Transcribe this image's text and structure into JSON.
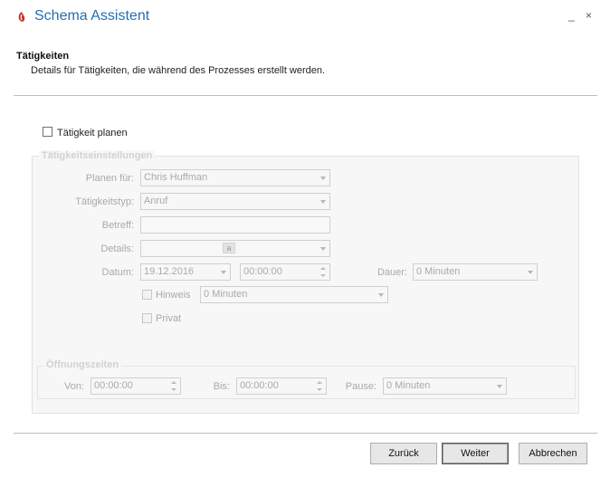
{
  "window": {
    "title": "Schema Assistent",
    "minimize": "_",
    "close": "×"
  },
  "header": {
    "heading": "Tätigkeiten",
    "description": "Details für Tätigkeiten, die während des Prozesses erstellt werden."
  },
  "plan_activity": {
    "label": "Tätigkeit planen",
    "checked": false
  },
  "settings": {
    "legend": "Tätigkeitseinstellungen",
    "plan_for": {
      "label": "Planen für:",
      "value": "Chris Huffman"
    },
    "type": {
      "label": "Tätigkeitstyp:",
      "value": "Anruf"
    },
    "subject": {
      "label": "Betreff:",
      "value": ""
    },
    "details": {
      "label": "Details:",
      "value": "",
      "icon_text": "a"
    },
    "date": {
      "label": "Datum:",
      "value": "19.12.2016",
      "time": "00:00:00"
    },
    "duration": {
      "label": "Dauer:",
      "value": "0 Minuten"
    },
    "reminder": {
      "label": "Hinweis",
      "value": "0 Minuten"
    },
    "private": {
      "label": "Privat"
    }
  },
  "opening": {
    "legend": "Öffnungszeiten",
    "from": {
      "label": "Von:",
      "value": "00:00:00"
    },
    "to": {
      "label": "Bis:",
      "value": "00:00:00"
    },
    "pause": {
      "label": "Pause:",
      "value": "0 Minuten"
    }
  },
  "buttons": {
    "back": "Zurück",
    "next": "Weiter",
    "cancel": "Abbrechen"
  },
  "colors": {
    "accent": "#1f6fb5",
    "logo": "#c0392b"
  }
}
